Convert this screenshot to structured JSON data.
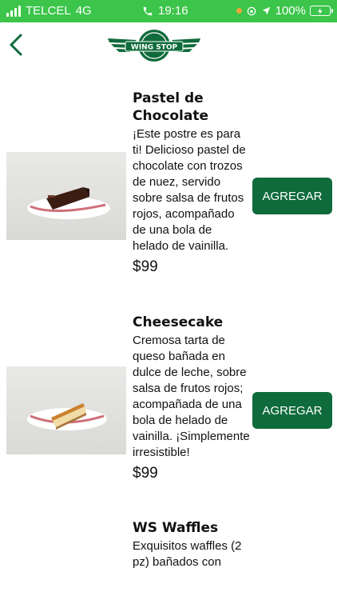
{
  "status_bar": {
    "carrier": "TELCEL",
    "network": "4G",
    "time": "19:16",
    "battery": "100%"
  },
  "header": {
    "logo_text": "WING STOP",
    "back_icon": "chevron-left-icon"
  },
  "colors": {
    "status_bar": "#3cc54a",
    "brand_green": "#0f6b3b"
  },
  "menu_items": [
    {
      "title": "Pastel de Chocolate",
      "description": "¡Este postre es para ti! Delicioso pastel de chocolate con trozos de nuez, servido sobre salsa de frutos rojos, acompañado de una bola de helado de vainilla.",
      "price": "$99",
      "button": "AGREGAR"
    },
    {
      "title": "Cheesecake",
      "description": "Cremosa tarta de queso bañada en dulce de leche, sobre salsa de frutos rojos; acompañada de una bola de helado de vainilla. ¡Simplemente irresistible!",
      "price": "$99",
      "button": "AGREGAR"
    },
    {
      "title": "WS Waffles",
      "description": "Exquisitos waffles (2 pz) bañados con",
      "price": "",
      "button": ""
    }
  ]
}
